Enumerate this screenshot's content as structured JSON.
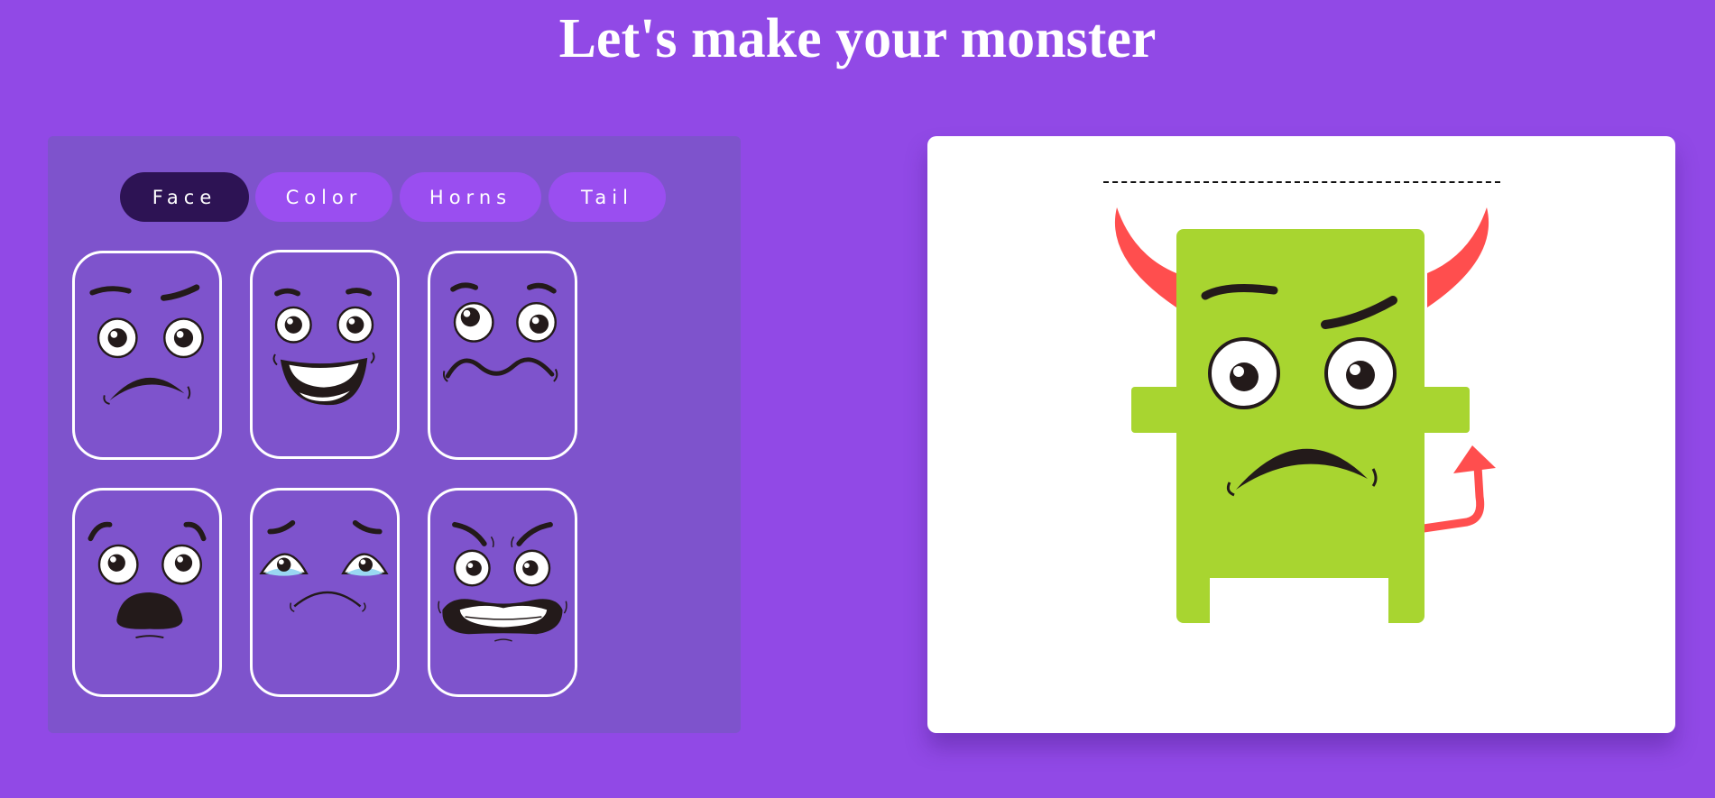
{
  "page": {
    "title": "Let's make your monster"
  },
  "tabs": [
    {
      "label": "Face",
      "active": true
    },
    {
      "label": "Color",
      "active": false
    },
    {
      "label": "Horns",
      "active": false
    },
    {
      "label": "Tail",
      "active": false
    }
  ],
  "faces": [
    {
      "id": "worried"
    },
    {
      "id": "happy"
    },
    {
      "id": "nervous"
    },
    {
      "id": "surprised"
    },
    {
      "id": "sad"
    },
    {
      "id": "angry"
    }
  ],
  "preview": {
    "name_value": "",
    "body_color": "#a8d530",
    "horn_color": "#ff4e4e",
    "tail_color": "#ff4e4e",
    "selected_face": "worried"
  },
  "colors": {
    "background": "#9149e6",
    "panel": "#7e53cc",
    "tab_active": "#2d1354",
    "tab": "#9a4ef0"
  }
}
